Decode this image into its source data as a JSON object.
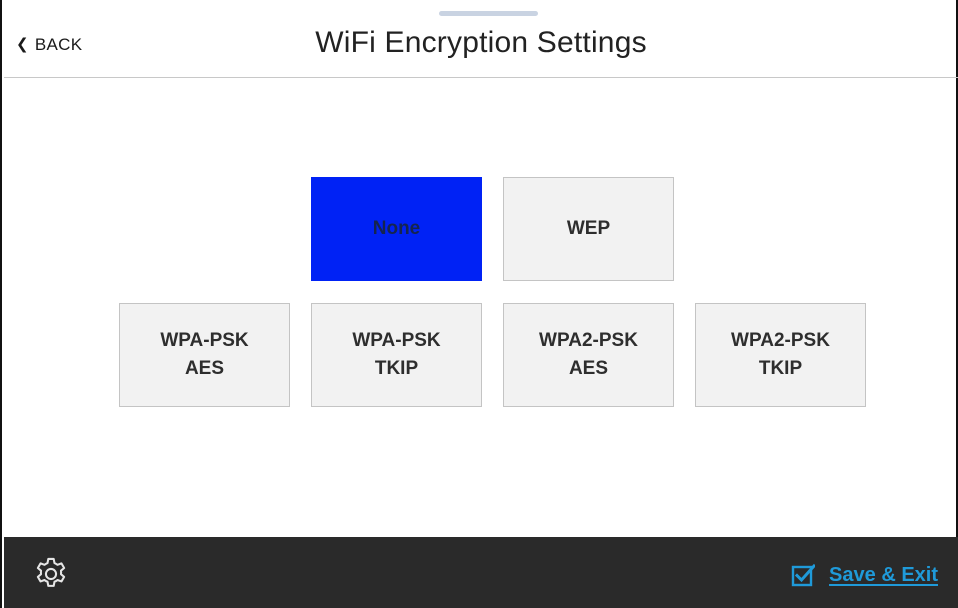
{
  "header": {
    "back_label": "BACK",
    "title": "WiFi Encryption Settings"
  },
  "options": {
    "selected": "None",
    "row1": [
      {
        "label": "None",
        "selected": true
      },
      {
        "label": "WEP",
        "selected": false
      }
    ],
    "row2": [
      {
        "label": "WPA-PSK\nAES",
        "selected": false
      },
      {
        "label": "WPA-PSK\nTKIP",
        "selected": false
      },
      {
        "label": "WPA2-PSK\nAES",
        "selected": false
      },
      {
        "label": "WPA2-PSK\nTKIP",
        "selected": false
      }
    ]
  },
  "footer": {
    "settings_icon": "gear-icon",
    "save_icon": "checkbox-checked-icon",
    "save_label": "Save & Exit"
  },
  "colors": {
    "selected_bg": "#0022f5",
    "option_bg": "#f2f2f2",
    "footer_bg": "#2a2a2a",
    "link": "#1f9ad9"
  }
}
